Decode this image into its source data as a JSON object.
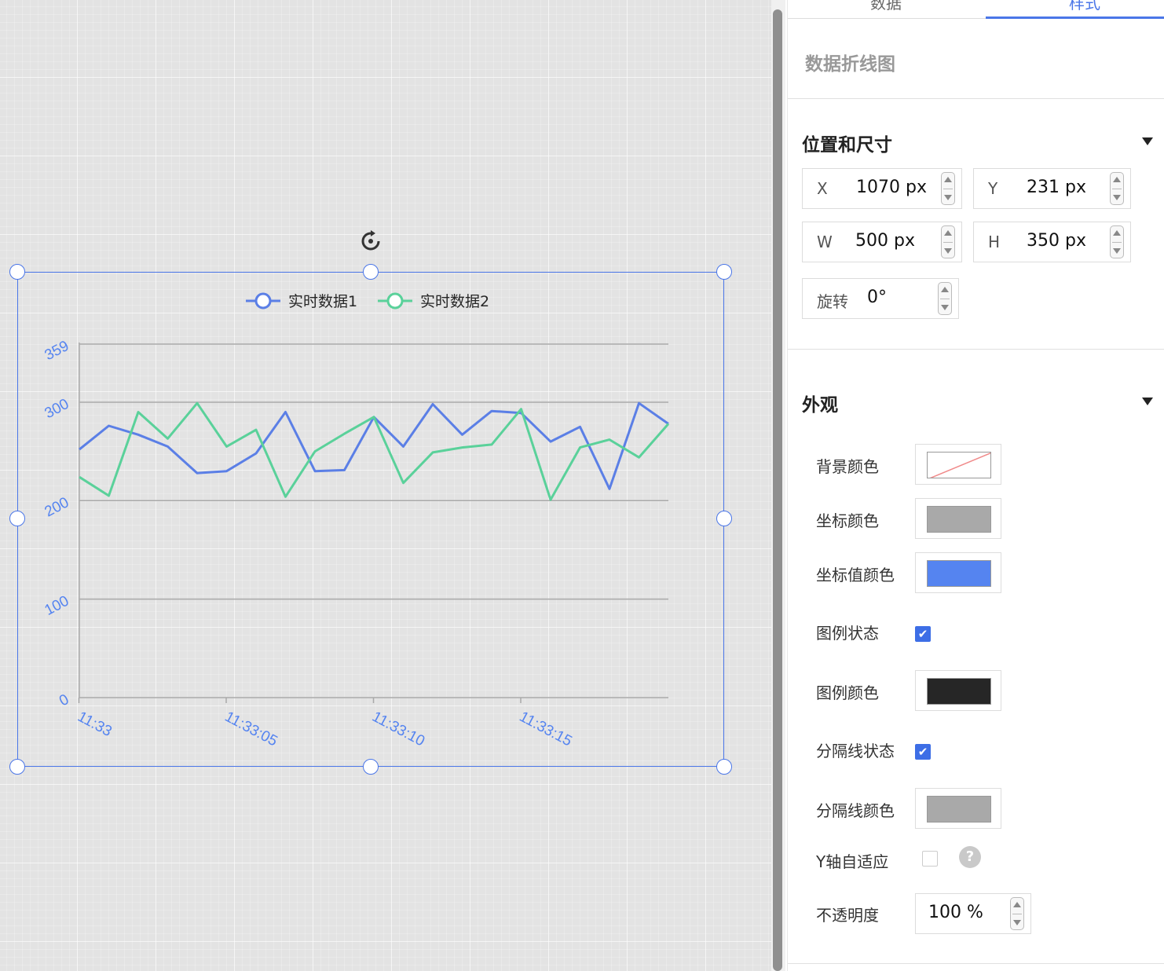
{
  "panel": {
    "tabs": [
      {
        "label": "数据"
      },
      {
        "label": "样式"
      }
    ],
    "component_title": "数据折线图",
    "position_section": {
      "title": "位置和尺寸",
      "x": {
        "label": "X",
        "value": "1070 px"
      },
      "y": {
        "label": "Y",
        "value": "231 px"
      },
      "w": {
        "label": "W",
        "value": "500 px"
      },
      "h": {
        "label": "H",
        "value": "350 px"
      },
      "rotation": {
        "label": "旋转",
        "value": "0°"
      }
    },
    "appearance_section": {
      "title": "外观",
      "background_color": {
        "label": "背景颜色",
        "color": "transparent"
      },
      "axis_color": {
        "label": "坐标颜色",
        "color": "#a9a9a9"
      },
      "axis_value_color": {
        "label": "坐标值颜色",
        "color": "#5584f0"
      },
      "legend_state": {
        "label": "图例状态",
        "checked": true
      },
      "legend_color": {
        "label": "图例颜色",
        "color": "#262626"
      },
      "divider_state": {
        "label": "分隔线状态",
        "checked": true
      },
      "divider_color": {
        "label": "分隔线颜色",
        "color": "#a9a9a9"
      },
      "y_auto": {
        "label": "Y轴自适应",
        "checked": false
      },
      "opacity": {
        "label": "不透明度",
        "value": "100 %"
      }
    }
  },
  "chart_data": {
    "type": "line",
    "x": [
      "11:33:00",
      "11:33:01",
      "11:33:02",
      "11:33:03",
      "11:33:04",
      "11:33:05",
      "11:33:06",
      "11:33:07",
      "11:33:08",
      "11:33:09",
      "11:33:10",
      "11:33:11",
      "11:33:12",
      "11:33:13",
      "11:33:14",
      "11:33:15",
      "11:33:16",
      "11:33:17",
      "11:33:18",
      "11:33:19",
      "11:33:20"
    ],
    "x_tick_labels": [
      {
        "x": "11:33:00",
        "label": "11:33"
      },
      {
        "x": "11:33:05",
        "label": "11:33:05"
      },
      {
        "x": "11:33:10",
        "label": "11:33:10"
      },
      {
        "x": "11:33:15",
        "label": "11:33:15"
      }
    ],
    "y_ticks": [
      0,
      100,
      200,
      300,
      359
    ],
    "ylim": [
      0,
      359
    ],
    "series": [
      {
        "name": "实时数据1",
        "color": "#5b7fe6",
        "values": [
          252,
          276,
          267,
          255,
          228,
          230,
          248,
          290,
          230,
          231,
          285,
          255,
          298,
          267,
          291,
          289,
          260,
          275,
          212,
          299,
          278
        ]
      },
      {
        "name": "实时数据2",
        "color": "#5ad19a",
        "values": [
          224,
          205,
          290,
          263,
          299,
          255,
          272,
          204,
          250,
          268,
          285,
          218,
          249,
          254,
          257,
          293,
          201,
          254,
          262,
          244,
          278
        ]
      }
    ],
    "legend": "top-center",
    "grid": true
  }
}
